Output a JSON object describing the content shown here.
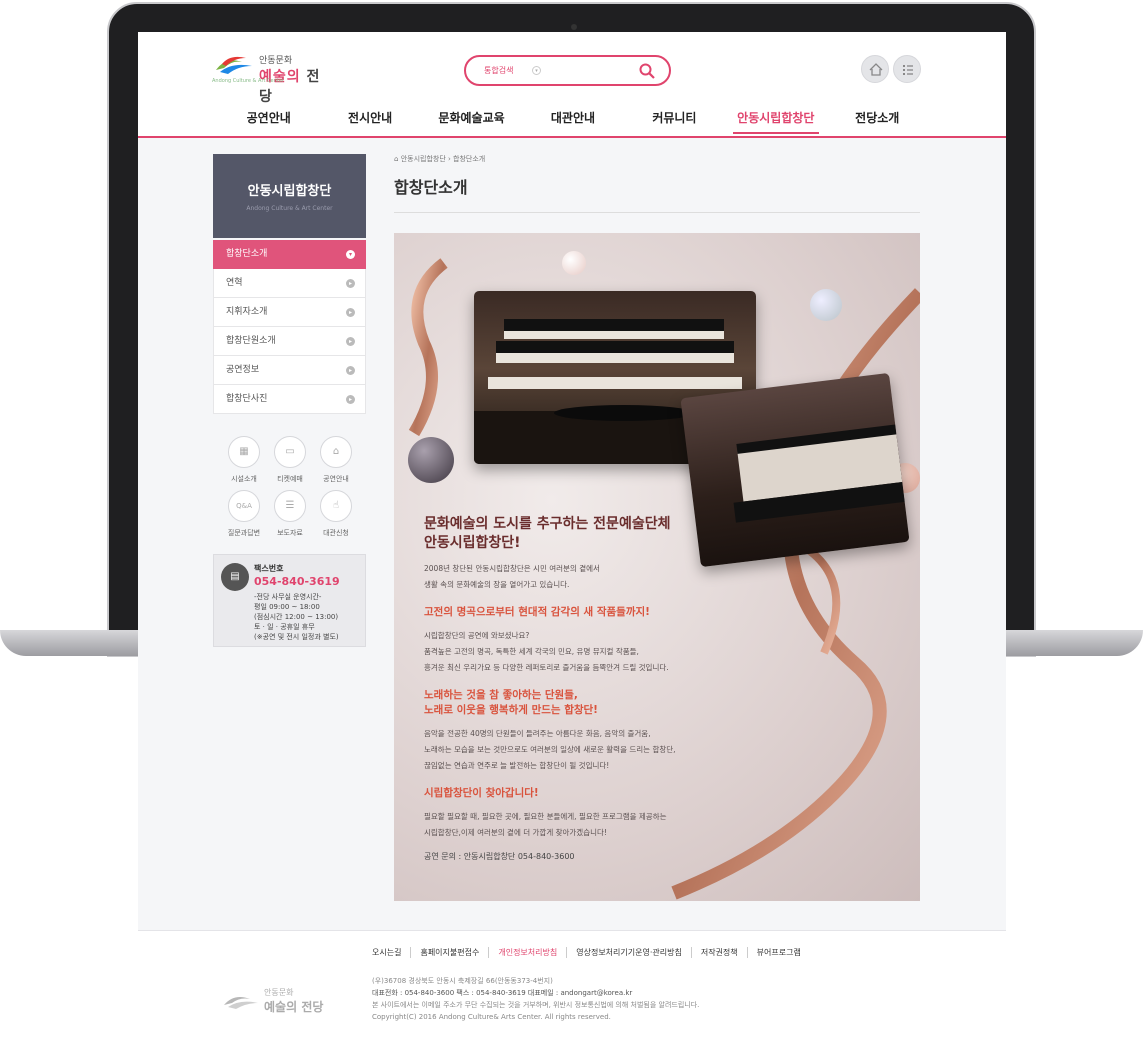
{
  "brand": {
    "name_small": "안동문화",
    "name_big_pink": "예술의",
    "name_big_rest": "전당",
    "name_en": "Andong Culture & Art Center"
  },
  "search": {
    "label": "통합검색",
    "icon": "search-icon"
  },
  "header_buttons": [
    {
      "icon": "home-icon"
    },
    {
      "icon": "sitemap-icon"
    }
  ],
  "gnb": [
    "공연안내",
    "전시안내",
    "문화예술교육",
    "대관안내",
    "커뮤니티",
    "안동시립합창단",
    "전당소개"
  ],
  "gnb_active_index": 5,
  "sidebar": {
    "title": "안동시립합창단",
    "subtitle": "Andong Culture & Art Center",
    "items": [
      "합창단소개",
      "연혁",
      "지휘자소개",
      "합창단원소개",
      "공연정보",
      "합창단사진"
    ],
    "active_index": 0
  },
  "quick_links": [
    {
      "label": "시설소개",
      "icon": "building-icon"
    },
    {
      "label": "티켓예매",
      "icon": "ticket-icon"
    },
    {
      "label": "공연안내",
      "icon": "spotlight-icon"
    },
    {
      "label": "질문과답변",
      "icon": "qa-icon"
    },
    {
      "label": "보도자료",
      "icon": "document-icon"
    },
    {
      "label": "대관신청",
      "icon": "hand-icon"
    }
  ],
  "fax": {
    "title": "팩스번호",
    "number": "054-840-3619",
    "hours": "-전당 사무실 운영시간-\n평일 09:00 ~ 18:00\n(점심시간 12:00 ~ 13:00)\n토 · 일 · 공휴일 휴무\n(※공연 및 전시 일정과 별도)"
  },
  "breadcrumb": {
    "parent": "안동시립합창단",
    "current": "합창단소개"
  },
  "page_title": "합창단소개",
  "poster": {
    "headline_1": "문화예술의 도시를 추구하는 전문예술단체",
    "headline_2": "안동시립합창단!",
    "intro_1": "2008년 창단된 안동시립합창단은 시민 여러분의 곁에서",
    "intro_2": "생활 속의 문화예술의 장을 열어가고 있습니다.",
    "section1_head": "고전의 명곡으로부터 현대적 감각의 새 작품들까지!",
    "section1_l1": "시립합창단의 공연에 와보셨나요?",
    "section1_l2": "품격높은 고전의 명곡, 독특한 세계 각국의 민요, 유명 뮤지컬 작품들,",
    "section1_l3": "흥겨운 최신 우리가요 등 다양한 레퍼토리로 즐거움을 듬뿍안겨 드릴 것입니다.",
    "section2_head_1": "노래하는 것을 참 좋아하는 단원들,",
    "section2_head_2": "노래로 이웃을 행복하게 만드는 합창단!",
    "section2_l1": "음악을 전공한 40명의 단원들이 들려주는 아름다운 화음, 음악의 즐거움,",
    "section2_l2": "노래하는 모습을 보는 것만으로도 여러분의 일상에 새로운 활력을 드리는 합창단,",
    "section2_l3": "끊임없는 연습과 연주로 늘 발전하는 합창단이 될 것입니다!",
    "section3_head": "시립합창단이 찾아갑니다!",
    "section3_l1": "필요할 필요할 때, 필요한 곳에, 필요한 분들에게, 필요한 프로그램을 제공하는",
    "section3_l2": "시립합창단,이제 여러분의 곁에 더 가깝게 찾아가겠습니다!",
    "contact": "공연 문의 : 안동시립합창단 054-840-3600"
  },
  "footer": {
    "links": [
      "오시는길",
      "홈페이지불편접수",
      "개인정보처리방침",
      "영상정보처리기기운영·관리방침",
      "저작권정책",
      "뷰어프로그램"
    ],
    "highlight_index": 2,
    "address": "(우)36708 경상북도 안동시 축제장길 66(안동동373-4번지)",
    "phone_line": "대표전화 : 054-840-3600   팩스 : 054-840-3619   대표메일 : andongart@korea.kr",
    "notice": "본 사이트에서는 이메일 주소가 무단 수집되는 것을 거부하며, 위반시 정보통신법에 의해 처벌됨을 알려드립니다.",
    "copyright": "Copyright(C) 2016 Andong Culture& Arts Center. All rights reserved."
  }
}
